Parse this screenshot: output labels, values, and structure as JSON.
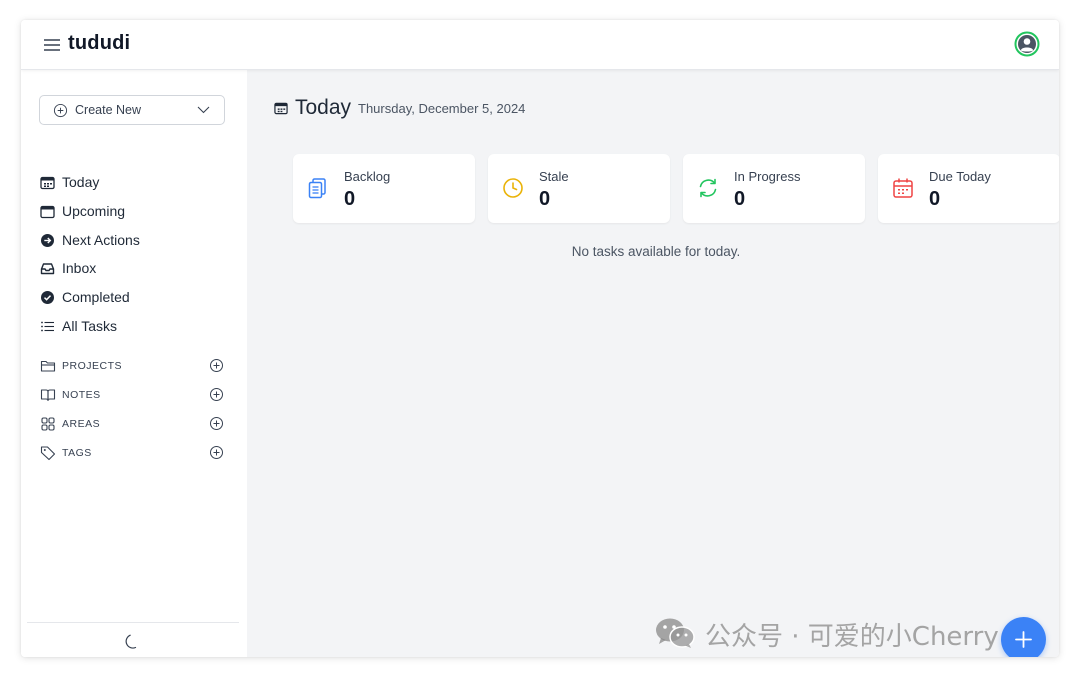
{
  "app": {
    "brand": "tududi"
  },
  "sidebar": {
    "create_new": "Create New",
    "nav": [
      {
        "label": "Today",
        "icon": "calendar-today-icon"
      },
      {
        "label": "Upcoming",
        "icon": "calendar-icon"
      },
      {
        "label": "Next Actions",
        "icon": "arrow-circle-icon"
      },
      {
        "label": "Inbox",
        "icon": "inbox-icon"
      },
      {
        "label": "Completed",
        "icon": "check-circle-icon"
      },
      {
        "label": "All Tasks",
        "icon": "list-icon"
      }
    ],
    "sections": [
      {
        "label": "PROJECTS",
        "icon": "folder-icon"
      },
      {
        "label": "NOTES",
        "icon": "book-icon"
      },
      {
        "label": "AREAS",
        "icon": "grid-icon"
      },
      {
        "label": "TAGS",
        "icon": "tag-icon"
      }
    ]
  },
  "main": {
    "title": "Today",
    "date": "Thursday, December 5, 2024",
    "cards": [
      {
        "label": "Backlog",
        "value": "0",
        "color": "#3b82f6",
        "icon": "clipboard-icon"
      },
      {
        "label": "Stale",
        "value": "0",
        "color": "#eab308",
        "icon": "clock-icon"
      },
      {
        "label": "In Progress",
        "value": "0",
        "color": "#22c55e",
        "icon": "refresh-icon"
      },
      {
        "label": "Due Today",
        "value": "0",
        "color": "#ef4444",
        "icon": "calendar-due-icon"
      }
    ],
    "empty_message": "No tasks available for today."
  },
  "watermark": {
    "text": "公众号 · 可爱的小Cherry",
    "icon": "wechat-icon"
  },
  "colors": {
    "accent": "#3b82f6",
    "avatar_ring": "#22c55e",
    "main_bg": "#f3f4f6"
  }
}
